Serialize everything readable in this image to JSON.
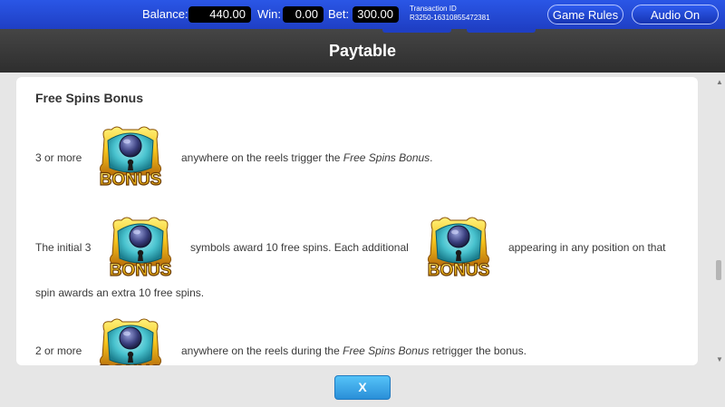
{
  "topbar": {
    "balance_label": "Balance:",
    "balance_value": "440.00",
    "win_label": "Win:",
    "win_value": "0.00",
    "bet_label": "Bet:",
    "bet_value": "300.00",
    "transaction_label": "Transaction ID",
    "transaction_value": "R3250-16310855472381",
    "game_rules_label": "Game Rules",
    "audio_label": "Audio On"
  },
  "header": {
    "title": "Paytable"
  },
  "section": {
    "title": "Free Spins Bonus",
    "symbol_text": "BONUS",
    "row1": {
      "prefix": "3 or more",
      "suffix": "anywhere on the reels trigger the ",
      "italic": "Free Spins Bonus",
      "end": "."
    },
    "row2": {
      "prefix": "The initial 3",
      "middle": "symbols award 10 free spins. Each additional",
      "suffix": "appearing in any position on that",
      "line2": "spin awards an extra 10 free spins."
    },
    "row3": {
      "prefix": "2 or more",
      "suffix": "anywhere on the reels during the ",
      "italic": "Free Spins Bonus",
      "end": " retrigger the bonus."
    }
  },
  "close_button_label": "X",
  "colors": {
    "topbar": "#1f3fc4",
    "header": "#3a3a3a",
    "close_button": "#3aa8ea",
    "bonus_gold": "#f5c21b",
    "bonus_teal": "#49c3cf"
  }
}
